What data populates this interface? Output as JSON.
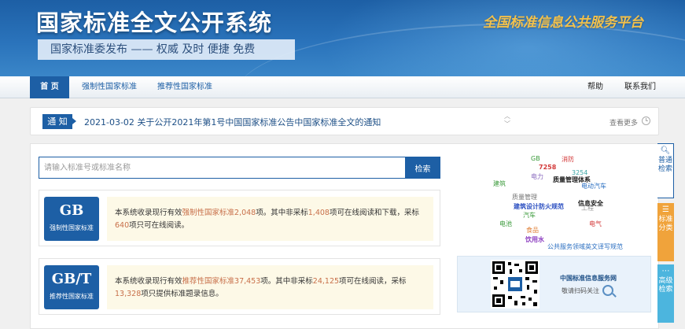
{
  "header": {
    "site_title": "国家标准全文公开系统",
    "slogan": "国家标准委发布 —— 权威  及时  便捷  免费",
    "platform_name": "全国标准信息公共服务平台"
  },
  "nav": {
    "home": "首 页",
    "mandatory": "强制性国家标准",
    "recommended": "推荐性国家标准",
    "help": "帮助",
    "contact": "联系我们"
  },
  "notice": {
    "tag": "通 知",
    "text": "2021-03-02  关于公开2021年第1号中国国家标准公告中国家标准全文的通知",
    "more": "查看更多"
  },
  "search": {
    "placeholder": "请输入标准号或标准名称",
    "button": "检索"
  },
  "gb": {
    "code": "GB",
    "label": "强制性国家标准",
    "t1": "本系统收录现行有效",
    "link": "强制性国家标准",
    "n_total": "2,048",
    "t2": "项。其中非采标",
    "n_online": "1,408",
    "t3": "项可在线阅读和下载，采标",
    "n_read": "640",
    "t4": "项只可在线阅读。"
  },
  "gbt": {
    "code": "GB/T",
    "label": "推荐性国家标准",
    "t1": "本系统收录现行有效",
    "link": "推荐性国家标准",
    "n_total": "37,453",
    "t2": "项。其中非采标",
    "n_online": "24,125",
    "t3": "项可在线阅读，采标",
    "n_read": "13,328",
    "t4": "项只提供标准题录信息。"
  },
  "tag_cloud": [
    {
      "text": "GB",
      "color": "#3a9a3a"
    },
    {
      "text": "消防",
      "color": "#d33a3a"
    },
    {
      "text": "7258",
      "color": "#d33a3a"
    },
    {
      "text": "电力",
      "color": "#8a6bbf"
    },
    {
      "text": "3254",
      "color": "#3aa6a6"
    },
    {
      "text": "质量管理体系",
      "color": "#222222"
    },
    {
      "text": "建筑",
      "color": "#3a9a3a"
    },
    {
      "text": "电动汽车",
      "color": "#2b6fc1"
    },
    {
      "text": "质量管理",
      "color": "#777777"
    },
    {
      "text": "工程",
      "color": "#999999"
    },
    {
      "text": "信息安全",
      "color": "#222222"
    },
    {
      "text": "建筑设计防火规范",
      "color": "#2b4fc1"
    },
    {
      "text": "汽车",
      "color": "#3a9a3a"
    },
    {
      "text": "电池",
      "color": "#3a9a3a"
    },
    {
      "text": "电气",
      "color": "#d33a3a"
    },
    {
      "text": "食品",
      "color": "#e0823a"
    },
    {
      "text": "饮用水",
      "color": "#8a3abf"
    },
    {
      "text": "公共服务领域英文译写规范",
      "color": "#2b6fc1"
    }
  ],
  "qr": {
    "title": "中国标准信息服务网",
    "sub": "敬请扫码关注"
  },
  "side": {
    "search": "普通检索",
    "category": "标准分类",
    "advanced": "高级检索"
  }
}
